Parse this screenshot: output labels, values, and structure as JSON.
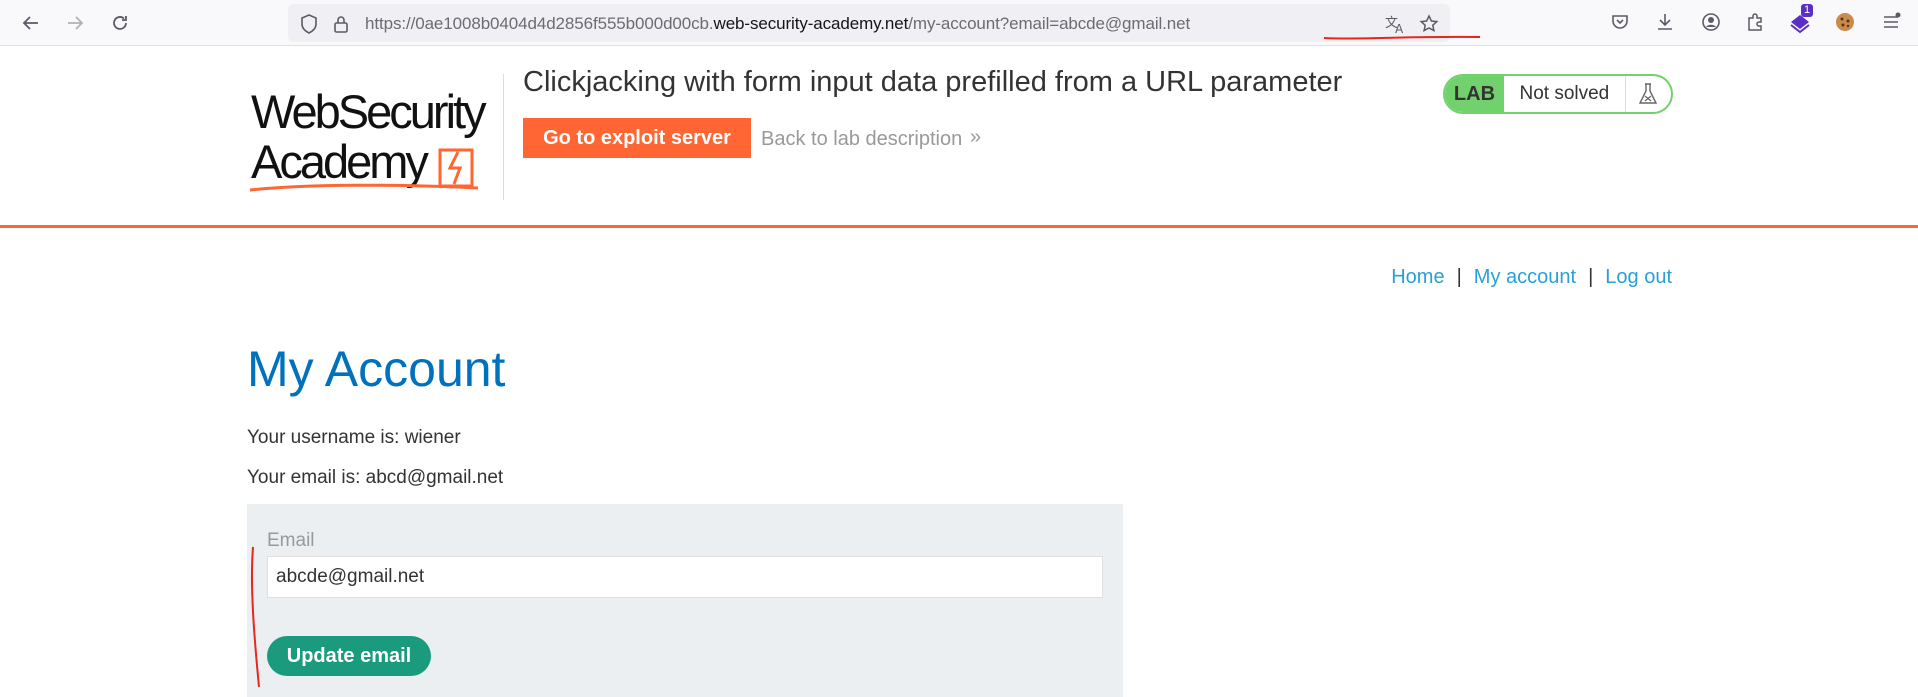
{
  "browser": {
    "url_prefix": "https://0ae1008b0404d4d2856f555b000d00cb.",
    "url_domain": "web-security-academy.net",
    "url_path": "/my-account?email=abcde@gmail.net",
    "extension_badge": "1"
  },
  "header": {
    "logo_line1": "WebSecurity",
    "logo_line2": "Academy",
    "lab_title": "Clickjacking with form input data prefilled from a URL parameter",
    "exploit_button": "Go to exploit server",
    "back_link": "Back to lab description",
    "back_chevron": "»",
    "badge_lab": "LAB",
    "badge_status": "Not solved",
    "accent_color": "#ff6633",
    "solved_color": "#70d16d"
  },
  "nav": {
    "home": "Home",
    "separator": "|",
    "my_account": "My account",
    "log_out": "Log out"
  },
  "main": {
    "title": "My Account",
    "username_line": "Your username is: wiener",
    "email_line": "Your email is: abcd@gmail.net",
    "form": {
      "email_label": "Email",
      "email_value": "abcde@gmail.net",
      "submit_label": "Update email",
      "submit_color": "#1a9b7e"
    }
  }
}
